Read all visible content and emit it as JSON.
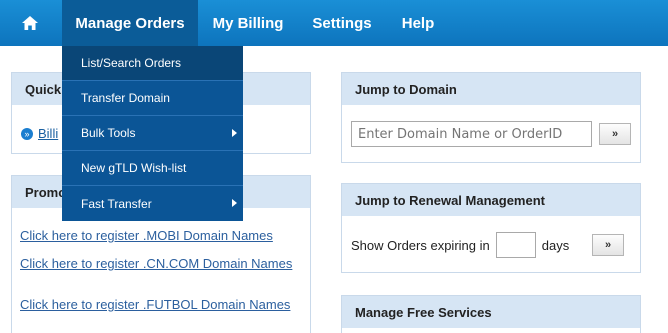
{
  "nav": {
    "home_icon": "home-icon",
    "items": [
      "Manage Orders",
      "My Billing",
      "Settings",
      "Help"
    ]
  },
  "dropdown": {
    "items": [
      {
        "label": "List/Search Orders",
        "has_submenu": false
      },
      {
        "label": "Transfer Domain",
        "has_submenu": false
      },
      {
        "label": "Bulk Tools",
        "has_submenu": true
      },
      {
        "label": "New gTLD Wish-list",
        "has_submenu": false
      },
      {
        "label": "Fast Transfer",
        "has_submenu": true
      }
    ]
  },
  "left": {
    "quick_title_visible": "Quick",
    "quick_link_visible": "Billi",
    "promo_title_visible": "Promo",
    "promo_links": [
      "Click here to register .MOBI Domain Names",
      "Click here to register .CN.COM Domain Names",
      "Click here to register .FUTBOL Domain Names"
    ]
  },
  "jump_domain": {
    "title": "Jump to Domain",
    "placeholder": "Enter Domain Name or OrderID",
    "button": "»"
  },
  "renewal": {
    "title": "Jump to Renewal Management",
    "prefix": "Show Orders expiring in",
    "suffix": "days",
    "button": "»"
  },
  "free_services": {
    "title": "Manage Free Services"
  },
  "colors": {
    "nav_bg": "#1a8fd6",
    "nav_active": "#0b5c98",
    "dropdown_bg": "#0b5596",
    "panel_head": "#d6e5f4",
    "link": "#2b5f9e"
  }
}
